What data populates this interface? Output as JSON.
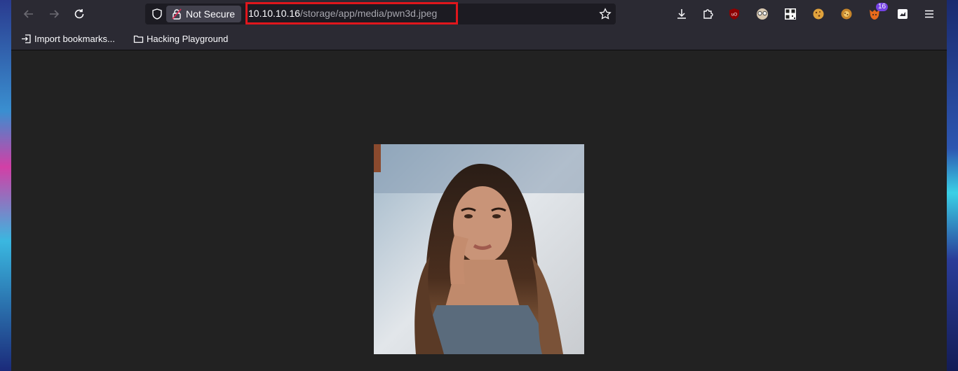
{
  "browser": {
    "security_label": "Not Secure",
    "url_host": "10.10.10.16",
    "url_path": "/storage/app/media/pwn3d.jpeg",
    "notification_count": "16"
  },
  "bookmarks": [
    {
      "label": "Import bookmarks...",
      "icon": "import-icon"
    },
    {
      "label": "Hacking Playground",
      "icon": "folder-icon"
    }
  ],
  "extensions": [
    "ublock-icon",
    "privacy-glasses-icon",
    "qr-code-icon",
    "cookie-icon",
    "cookie-editor-icon",
    "foxyproxy-icon",
    "container-icon"
  ],
  "colors": {
    "toolbar": "#2b2a33",
    "urlbar": "#1c1b22",
    "highlight": "#e0161c",
    "content": "#222222"
  }
}
